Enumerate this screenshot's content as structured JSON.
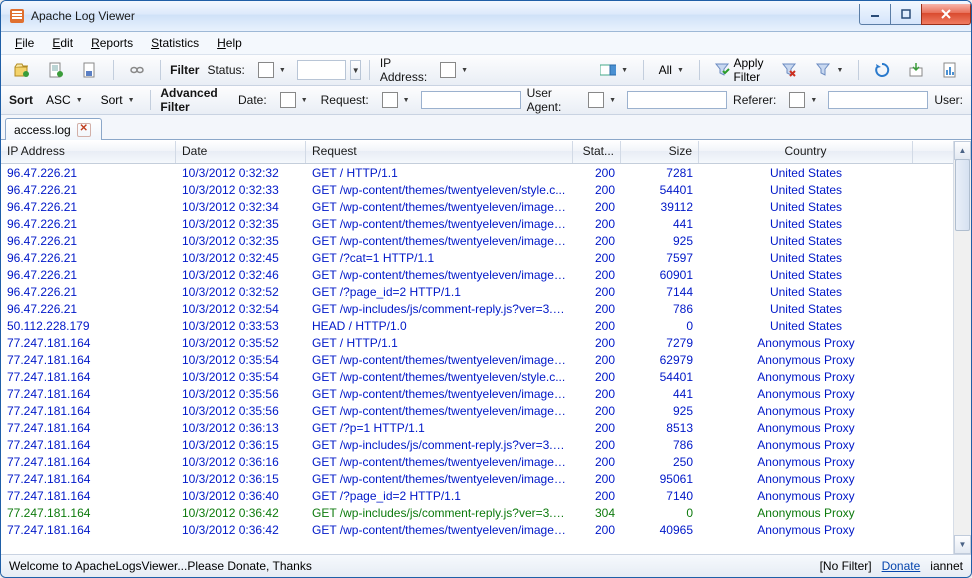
{
  "window": {
    "title": "Apache Log Viewer"
  },
  "menu": {
    "file": "File",
    "edit": "Edit",
    "reports": "Reports",
    "statistics": "Statistics",
    "help": "Help"
  },
  "toolbar": {
    "filter_label": "Filter",
    "status_label": "Status:",
    "ip_label": "IP Address:",
    "all_label": "All",
    "apply_label": "Apply Filter"
  },
  "toolbar2": {
    "sort_label": "Sort",
    "asc_label": "ASC",
    "sort2_label": "Sort",
    "adv_label": "Advanced Filter",
    "date_label": "Date:",
    "request_label": "Request:",
    "useragent_label": "User Agent:",
    "referer_label": "Referer:",
    "user_label": "User:"
  },
  "tab": {
    "name": "access.log"
  },
  "columns": {
    "ip": "IP Address",
    "date": "Date",
    "req": "Request",
    "stat": "Stat...",
    "size": "Size",
    "country": "Country"
  },
  "rows": [
    {
      "ip": "96.47.226.21",
      "date": "10/3/2012 0:32:32",
      "req": "GET / HTTP/1.1",
      "stat": "200",
      "size": "7281",
      "country": "United States",
      "s": 0
    },
    {
      "ip": "96.47.226.21",
      "date": "10/3/2012 0:32:33",
      "req": "GET /wp-content/themes/twentyeleven/style.c...",
      "stat": "200",
      "size": "54401",
      "country": "United States",
      "s": 0
    },
    {
      "ip": "96.47.226.21",
      "date": "10/3/2012 0:32:34",
      "req": "GET /wp-content/themes/twentyeleven/images...",
      "stat": "200",
      "size": "39112",
      "country": "United States",
      "s": 0
    },
    {
      "ip": "96.47.226.21",
      "date": "10/3/2012 0:32:35",
      "req": "GET /wp-content/themes/twentyeleven/images...",
      "stat": "200",
      "size": "441",
      "country": "United States",
      "s": 0
    },
    {
      "ip": "96.47.226.21",
      "date": "10/3/2012 0:32:35",
      "req": "GET /wp-content/themes/twentyeleven/images...",
      "stat": "200",
      "size": "925",
      "country": "United States",
      "s": 0
    },
    {
      "ip": "96.47.226.21",
      "date": "10/3/2012 0:32:45",
      "req": "GET /?cat=1 HTTP/1.1",
      "stat": "200",
      "size": "7597",
      "country": "United States",
      "s": 0
    },
    {
      "ip": "96.47.226.21",
      "date": "10/3/2012 0:32:46",
      "req": "GET /wp-content/themes/twentyeleven/images...",
      "stat": "200",
      "size": "60901",
      "country": "United States",
      "s": 0
    },
    {
      "ip": "96.47.226.21",
      "date": "10/3/2012 0:32:52",
      "req": "GET /?page_id=2 HTTP/1.1",
      "stat": "200",
      "size": "7144",
      "country": "United States",
      "s": 0
    },
    {
      "ip": "96.47.226.21",
      "date": "10/3/2012 0:32:54",
      "req": "GET /wp-includes/js/comment-reply.js?ver=3.4....",
      "stat": "200",
      "size": "786",
      "country": "United States",
      "s": 0
    },
    {
      "ip": "50.112.228.179",
      "date": "10/3/2012 0:33:53",
      "req": "HEAD / HTTP/1.0",
      "stat": "200",
      "size": "0",
      "country": "United States",
      "s": 0
    },
    {
      "ip": "77.247.181.164",
      "date": "10/3/2012 0:35:52",
      "req": "GET / HTTP/1.1",
      "stat": "200",
      "size": "7279",
      "country": "Anonymous Proxy",
      "s": 0
    },
    {
      "ip": "77.247.181.164",
      "date": "10/3/2012 0:35:54",
      "req": "GET /wp-content/themes/twentyeleven/images...",
      "stat": "200",
      "size": "62979",
      "country": "Anonymous Proxy",
      "s": 0
    },
    {
      "ip": "77.247.181.164",
      "date": "10/3/2012 0:35:54",
      "req": "GET /wp-content/themes/twentyeleven/style.c...",
      "stat": "200",
      "size": "54401",
      "country": "Anonymous Proxy",
      "s": 0
    },
    {
      "ip": "77.247.181.164",
      "date": "10/3/2012 0:35:56",
      "req": "GET /wp-content/themes/twentyeleven/images...",
      "stat": "200",
      "size": "441",
      "country": "Anonymous Proxy",
      "s": 0
    },
    {
      "ip": "77.247.181.164",
      "date": "10/3/2012 0:35:56",
      "req": "GET /wp-content/themes/twentyeleven/images...",
      "stat": "200",
      "size": "925",
      "country": "Anonymous Proxy",
      "s": 0
    },
    {
      "ip": "77.247.181.164",
      "date": "10/3/2012 0:36:13",
      "req": "GET /?p=1 HTTP/1.1",
      "stat": "200",
      "size": "8513",
      "country": "Anonymous Proxy",
      "s": 0
    },
    {
      "ip": "77.247.181.164",
      "date": "10/3/2012 0:36:15",
      "req": "GET /wp-includes/js/comment-reply.js?ver=3.4....",
      "stat": "200",
      "size": "786",
      "country": "Anonymous Proxy",
      "s": 0
    },
    {
      "ip": "77.247.181.164",
      "date": "10/3/2012 0:36:16",
      "req": "GET /wp-content/themes/twentyeleven/images...",
      "stat": "200",
      "size": "250",
      "country": "Anonymous Proxy",
      "s": 0
    },
    {
      "ip": "77.247.181.164",
      "date": "10/3/2012 0:36:15",
      "req": "GET /wp-content/themes/twentyeleven/images...",
      "stat": "200",
      "size": "95061",
      "country": "Anonymous Proxy",
      "s": 0
    },
    {
      "ip": "77.247.181.164",
      "date": "10/3/2012 0:36:40",
      "req": "GET /?page_id=2 HTTP/1.1",
      "stat": "200",
      "size": "7140",
      "country": "Anonymous Proxy",
      "s": 0
    },
    {
      "ip": "77.247.181.164",
      "date": "10/3/2012 0:36:42",
      "req": "GET /wp-includes/js/comment-reply.js?ver=3.4....",
      "stat": "304",
      "size": "0",
      "country": "Anonymous Proxy",
      "s": 1
    },
    {
      "ip": "77.247.181.164",
      "date": "10/3/2012 0:36:42",
      "req": "GET /wp-content/themes/twentyeleven/images...",
      "stat": "200",
      "size": "40965",
      "country": "Anonymous Proxy",
      "s": 0
    }
  ],
  "status": {
    "welcome": "Welcome to ApacheLogsViewer...Please Donate, Thanks",
    "nofilter": "[No Filter]",
    "donate": "Donate",
    "user": "iannet"
  }
}
